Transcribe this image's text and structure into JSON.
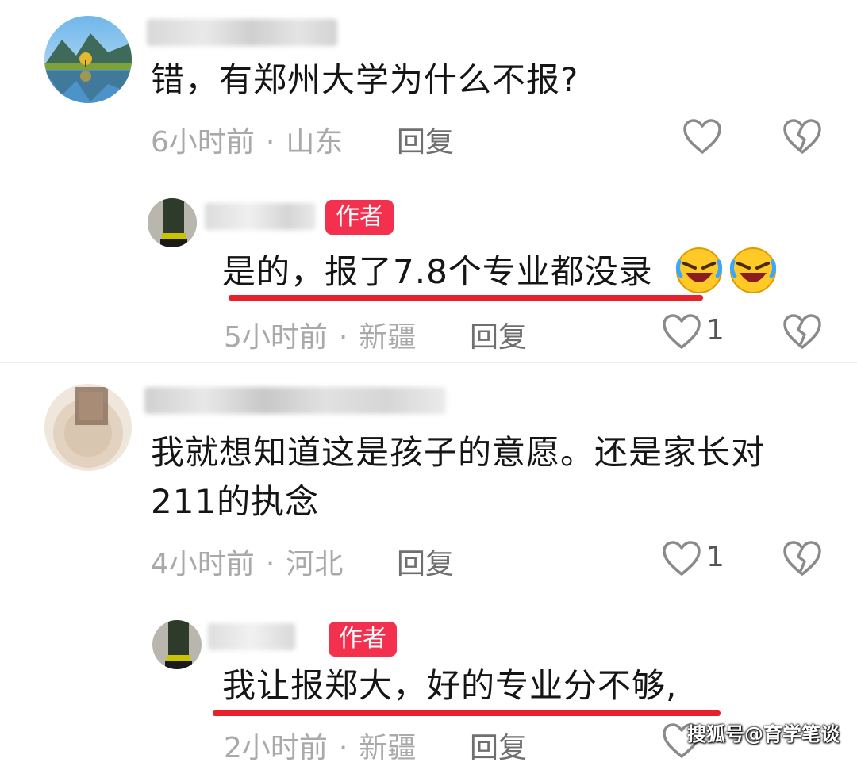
{
  "comments": [
    {
      "text": "错，有郑州大学为什么不报?",
      "time": "6小时前",
      "location": "山东",
      "reply_label": "回复"
    },
    {
      "badge": "作者",
      "text": "是的，报了7.8个专业都没录",
      "time": "5小时前",
      "location": "新疆",
      "reply_label": "回复",
      "like_count": "1"
    },
    {
      "text_line1": "我就想知道这是孩子的意愿。还是家长对",
      "text_line2": "211的执念",
      "time": "4小时前",
      "location": "河北",
      "reply_label": "回复",
      "like_count": "1"
    },
    {
      "badge": "作者",
      "text": "我让报郑大，好的专业分不够,",
      "time": "2小时前",
      "location": "新疆",
      "reply_label": "回复"
    }
  ],
  "separator": "·",
  "icons": {
    "like": "heart-outline-icon",
    "dislike": "broken-heart-icon",
    "emoji": "laughing-crying-emoji"
  },
  "colors": {
    "badge": "#f4304f",
    "underline": "#e8202a"
  },
  "watermark": "搜狐号@育学笔谈"
}
